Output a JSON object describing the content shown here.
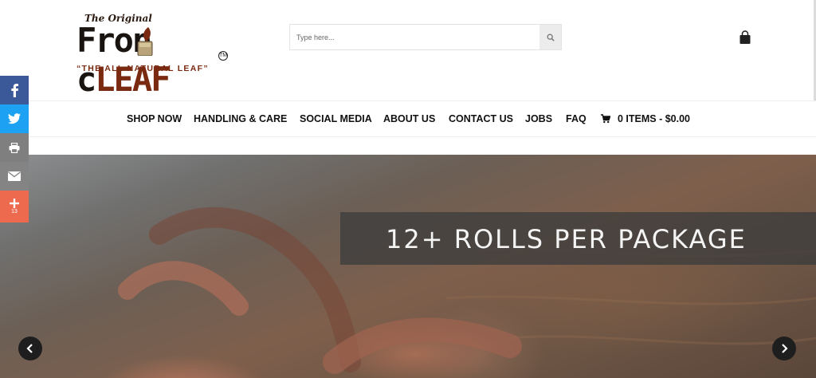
{
  "brand": {
    "script_text": "The Original",
    "name_left": "Fron",
    "name_right": "LEAF",
    "name_mid": "c",
    "tm": "TM",
    "tagline": "“THE ALL NATURAL LEAF”",
    "accent_color": "#7b2a12"
  },
  "search": {
    "placeholder": "Type here...",
    "icon": "search-icon"
  },
  "header": {
    "bag_icon": "shopping-bag-icon"
  },
  "nav": {
    "items": [
      {
        "label": "SHOP NOW"
      },
      {
        "label": "HANDLING & CARE"
      },
      {
        "label": "SOCIAL MEDIA"
      },
      {
        "label": "ABOUT US"
      },
      {
        "label": "CONTACT US"
      },
      {
        "label": "JOBS"
      },
      {
        "label": "FAQ"
      }
    ],
    "cart_label": "0 ITEMS - $0.00",
    "cart_icon": "cart-icon"
  },
  "hero": {
    "caption": "12+ ROLLS PER PACKAGE",
    "prev_icon": "chevron-left-icon",
    "next_icon": "chevron-right-icon"
  },
  "social": {
    "buttons": [
      {
        "name": "facebook",
        "icon": "facebook-icon",
        "color": "#3b5998"
      },
      {
        "name": "twitter",
        "icon": "twitter-icon",
        "color": "#1da1f2"
      },
      {
        "name": "print",
        "icon": "print-icon",
        "color": "#7f7f7f"
      },
      {
        "name": "email",
        "icon": "email-icon",
        "color": "#848484"
      },
      {
        "name": "more",
        "icon": "plus-icon",
        "color": "#ee6a4f"
      }
    ],
    "share_count": "13"
  }
}
